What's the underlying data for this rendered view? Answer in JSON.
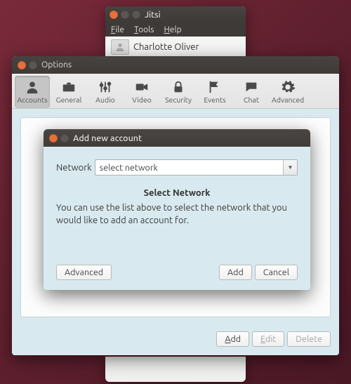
{
  "jitsi": {
    "title": "Jitsi",
    "menu": {
      "file": "File",
      "tools": "Tools",
      "help": "Help"
    },
    "contact": {
      "name": "Charlotte Oliver"
    }
  },
  "options": {
    "title": "Options",
    "toolbar": {
      "accounts": "Accounts",
      "general": "General",
      "audio": "Audio",
      "video": "Video",
      "security": "Security",
      "events": "Events",
      "chat": "Chat",
      "advanced": "Advanced"
    },
    "buttons": {
      "add": "Add",
      "edit": "Edit",
      "delete": "Delete"
    }
  },
  "dialog": {
    "title": "Add new account",
    "network_label": "Network",
    "network_value": "select network",
    "heading": "Select Network",
    "description": "You can use the list above to select the network that you would like to add an account for.",
    "buttons": {
      "advanced": "Advanced",
      "add": "Add",
      "cancel": "Cancel"
    }
  }
}
